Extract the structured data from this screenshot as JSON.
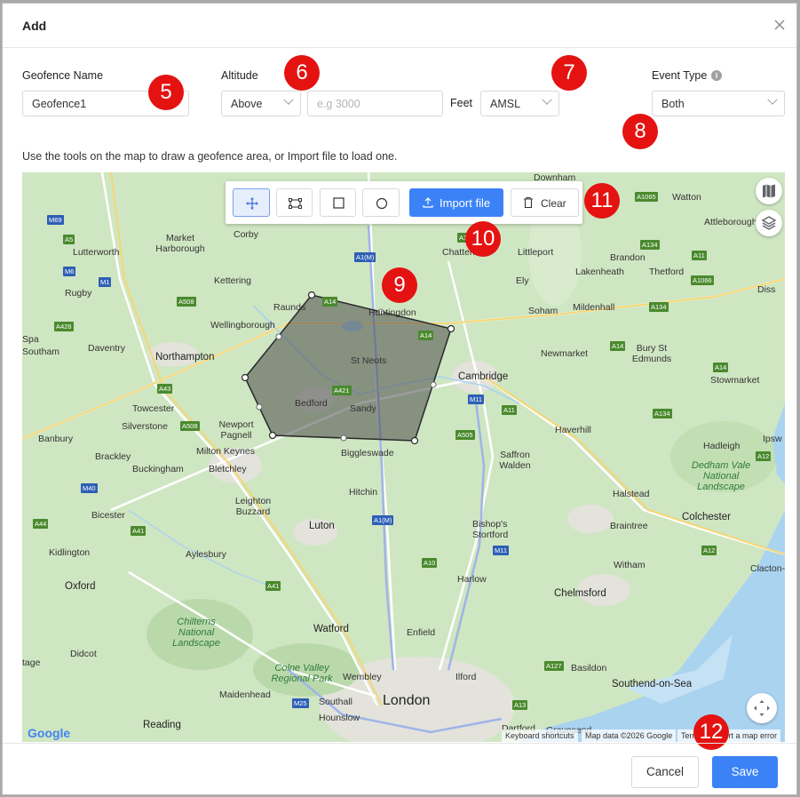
{
  "dialog": {
    "title": "Add"
  },
  "form": {
    "geofence_name_label": "Geofence Name",
    "geofence_name_value": "Geofence1",
    "altitude_label": "Altitude",
    "altitude_mode": "Above",
    "altitude_placeholder": "e.g 3000",
    "altitude_unit": "Feet",
    "altitude_ref": "AMSL",
    "event_type_label": "Event Type",
    "event_type_value": "Both",
    "info_glyph": "i"
  },
  "hint": "Use the tools on the map to draw a geofence area, or Import file to load one.",
  "toolbar": {
    "import_label": "Import file",
    "clear_label": "Clear"
  },
  "badges": {
    "b5": "5",
    "b6": "6",
    "b7": "7",
    "b8": "8",
    "b9": "9",
    "b10": "10",
    "b11": "11",
    "b12": "12"
  },
  "map": {
    "places": {
      "downham": "Downham",
      "watton": "Watton",
      "attleborough": "Attleborough",
      "lutterworth": "Lutterworth",
      "market_harborough": "Market Harborough",
      "corby": "Corby",
      "chatteris": "Chatteris",
      "littleport": "Littleport",
      "brandon": "Brandon",
      "lakenheath": "Lakenheath",
      "thetford": "Thetford",
      "rugby": "Rugby",
      "kettering": "Kettering",
      "raunds": "Raunds",
      "huntingdon": "Huntingdon",
      "ely": "Ely",
      "diss": "Diss",
      "mildenhall": "Mildenhall",
      "soham": "Soham",
      "wellingborough": "Wellingborough",
      "spa": "Spa",
      "southam": "Southam",
      "daventry": "Daventry",
      "northampton": "Northampton",
      "st_neots": "St Neots",
      "newmarket": "Newmarket",
      "bury": "Bury St Edmunds",
      "cambridge": "Cambridge",
      "stowmarket": "Stowmarket",
      "towcester": "Towcester",
      "bedford": "Bedford",
      "sandy": "Sandy",
      "silverstone": "Silverstone",
      "newport_pagnell": "Newport Pagnell",
      "haverhill": "Haverhill",
      "biggleswade": "Biggleswade",
      "banbury": "Banbury",
      "milton_keynes": "Milton Keynes",
      "brackley": "Brackley",
      "saffron": "Saffron Walden",
      "hadleigh": "Hadleigh",
      "ipswich": "Ipsw",
      "buckingham": "Buckingham",
      "bletchley": "Bletchley",
      "dedham": "Dedham Vale National Landscape",
      "hitchin": "Hitchin",
      "halstead": "Halstead",
      "bicester": "Bicester",
      "leighton": "Leighton Buzzard",
      "colchester": "Colchester",
      "bishops": "Bishop's Stortford",
      "luton": "Luton",
      "braintree": "Braintree",
      "kidlington": "Kidlington",
      "aylesbury": "Aylesbury",
      "witham": "Witham",
      "clacton": "Clacton-",
      "oxford": "Oxford",
      "harlow": "Harlow",
      "chelmsford": "Chelmsford",
      "chilterns": "Chilterns National Landscape",
      "watford": "Watford",
      "enfield": "Enfield",
      "didcot": "Didcot",
      "tage": "tage",
      "colne": "Colne Valley Regional Park",
      "wembley": "Wembley",
      "ilford": "Ilford",
      "basildon": "Basildon",
      "maidenhead": "Maidenhead",
      "southend": "Southend-on-Sea",
      "southall": "Southall",
      "london": "London",
      "hounslow": "Hounslow",
      "reading": "Reading",
      "dartford": "Dartford",
      "gravesend": "Gravesend"
    },
    "roads": {
      "r1": "A1065",
      "r2": "M69",
      "r3": "A5",
      "r4": "A134",
      "r5": "A11",
      "r6": "M6",
      "r7": "A1(M)",
      "r8": "A10",
      "r9": "A1066",
      "r10": "M1",
      "r11": "A508",
      "r12": "A14",
      "r13": "A134",
      "r14": "A426",
      "r15": "A14",
      "r16": "A14",
      "r17": "A14",
      "r18": "A43",
      "r19": "A421",
      "r20": "M11",
      "r21": "A11",
      "r22": "A134",
      "r23": "A508",
      "r24": "A505",
      "r25": "A12",
      "r26": "M40",
      "r27": "A1(M)",
      "r28": "A44",
      "r29": "A41",
      "r30": "M11",
      "r31": "A10",
      "r32": "A12",
      "r33": "A41",
      "r34": "A127",
      "r35": "M25",
      "r36": "A13"
    },
    "attribution": {
      "logo": "Google",
      "shortcuts": "Keyboard shortcuts",
      "data": "Map data ©2026 Google",
      "terms": "Terms",
      "report": "Report a map error"
    }
  },
  "footer": {
    "cancel_label": "Cancel",
    "save_label": "Save"
  },
  "colors": {
    "accent": "#3b82f6",
    "badge": "#e51212",
    "map_land": "#cfe6c2",
    "water": "#aad3f0",
    "polygon": "#4a4a4a"
  },
  "icons": [
    "close-icon",
    "chevron-down-icon",
    "info-icon",
    "move-icon",
    "polygon-icon",
    "square-icon",
    "circle-icon",
    "upload-icon",
    "trash-icon",
    "map-type-icon",
    "layers-icon",
    "recenter-icon"
  ]
}
